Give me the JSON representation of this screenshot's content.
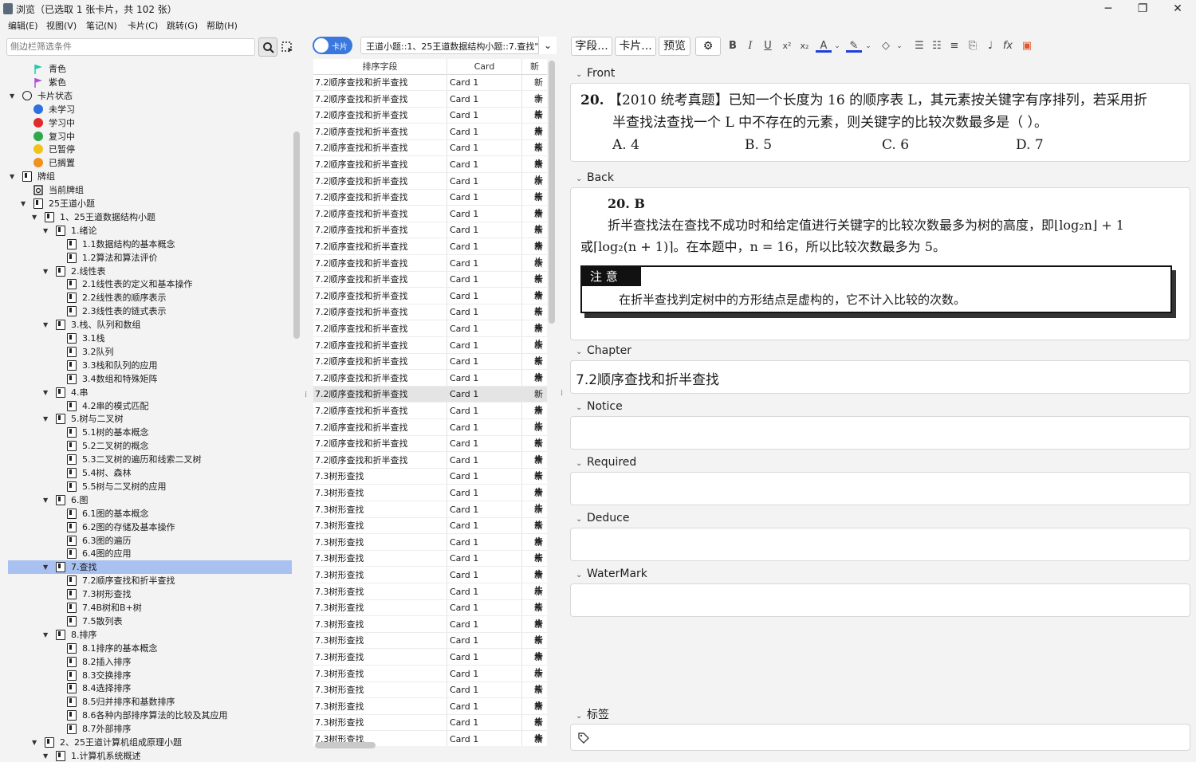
{
  "window": {
    "title": "浏览（已选取 1 张卡片，共 102 张）",
    "minimize": "─",
    "maximize": "❐",
    "close": "✕"
  },
  "menu": [
    "编辑(E)",
    "视图(V)",
    "笔记(N)",
    "卡片(C)",
    "跳转(G)",
    "帮助(H)"
  ],
  "sidebar": {
    "search_placeholder": "侧边栏筛选条件",
    "tree": [
      {
        "label": "青色",
        "level": 2,
        "icon": "flag-cyan",
        "color": "#27c9a6",
        "arrow": ""
      },
      {
        "label": "紫色",
        "level": 2,
        "icon": "flag-purple",
        "color": "#b04fe0",
        "arrow": ""
      },
      {
        "label": "卡片状态",
        "level": 1,
        "icon": "circle-outline",
        "color": "#222",
        "arrow": "down"
      },
      {
        "label": "未学习",
        "level": 2,
        "icon": "dot",
        "color": "#2f6fe0",
        "arrow": ""
      },
      {
        "label": "学习中",
        "level": 2,
        "icon": "dot",
        "color": "#e02b2b",
        "arrow": ""
      },
      {
        "label": "复习中",
        "level": 2,
        "icon": "dot",
        "color": "#2ea84a",
        "arrow": ""
      },
      {
        "label": "已暂停",
        "level": 2,
        "icon": "dot",
        "color": "#f2c21b",
        "arrow": ""
      },
      {
        "label": "已搁置",
        "level": 2,
        "icon": "dot",
        "color": "#f0921e",
        "arrow": ""
      },
      {
        "label": "牌组",
        "level": 1,
        "icon": "deck",
        "color": "#222",
        "arrow": "down"
      },
      {
        "label": "当前牌组",
        "level": 2,
        "icon": "deck-current",
        "color": "#222",
        "arrow": ""
      },
      {
        "label": "25王道小题",
        "level": 2,
        "icon": "deck",
        "color": "#222",
        "arrow": "down"
      },
      {
        "label": "1、25王道数据结构小题",
        "level": 3,
        "icon": "deck",
        "color": "#222",
        "arrow": "down"
      },
      {
        "label": "1.绪论",
        "level": 4,
        "icon": "deck",
        "color": "#222",
        "arrow": "down"
      },
      {
        "label": "1.1数据结构的基本概念",
        "level": 5,
        "icon": "deck",
        "color": "#222",
        "arrow": ""
      },
      {
        "label": "1.2算法和算法评价",
        "level": 5,
        "icon": "deck",
        "color": "#222",
        "arrow": ""
      },
      {
        "label": "2.线性表",
        "level": 4,
        "icon": "deck",
        "color": "#222",
        "arrow": "down"
      },
      {
        "label": "2.1线性表的定义和基本操作",
        "level": 5,
        "icon": "deck",
        "color": "#222",
        "arrow": ""
      },
      {
        "label": "2.2线性表的顺序表示",
        "level": 5,
        "icon": "deck",
        "color": "#222",
        "arrow": ""
      },
      {
        "label": "2.3线性表的链式表示",
        "level": 5,
        "icon": "deck",
        "color": "#222",
        "arrow": ""
      },
      {
        "label": "3.栈、队列和数组",
        "level": 4,
        "icon": "deck",
        "color": "#222",
        "arrow": "down"
      },
      {
        "label": "3.1栈",
        "level": 5,
        "icon": "deck",
        "color": "#222",
        "arrow": ""
      },
      {
        "label": "3.2队列",
        "level": 5,
        "icon": "deck",
        "color": "#222",
        "arrow": ""
      },
      {
        "label": "3.3栈和队列的应用",
        "level": 5,
        "icon": "deck",
        "color": "#222",
        "arrow": ""
      },
      {
        "label": "3.4数组和特殊矩阵",
        "level": 5,
        "icon": "deck",
        "color": "#222",
        "arrow": ""
      },
      {
        "label": "4.串",
        "level": 4,
        "icon": "deck",
        "color": "#222",
        "arrow": "down"
      },
      {
        "label": "4.2串的模式匹配",
        "level": 5,
        "icon": "deck",
        "color": "#222",
        "arrow": ""
      },
      {
        "label": "5.树与二叉树",
        "level": 4,
        "icon": "deck",
        "color": "#222",
        "arrow": "down"
      },
      {
        "label": "5.1树的基本概念",
        "level": 5,
        "icon": "deck",
        "color": "#222",
        "arrow": ""
      },
      {
        "label": "5.2二叉树的概念",
        "level": 5,
        "icon": "deck",
        "color": "#222",
        "arrow": ""
      },
      {
        "label": "5.3二叉树的遍历和线索二叉树",
        "level": 5,
        "icon": "deck",
        "color": "#222",
        "arrow": ""
      },
      {
        "label": "5.4树、森林",
        "level": 5,
        "icon": "deck",
        "color": "#222",
        "arrow": ""
      },
      {
        "label": "5.5树与二叉树的应用",
        "level": 5,
        "icon": "deck",
        "color": "#222",
        "arrow": ""
      },
      {
        "label": "6.图",
        "level": 4,
        "icon": "deck",
        "color": "#222",
        "arrow": "down"
      },
      {
        "label": "6.1图的基本概念",
        "level": 5,
        "icon": "deck",
        "color": "#222",
        "arrow": ""
      },
      {
        "label": "6.2图的存储及基本操作",
        "level": 5,
        "icon": "deck",
        "color": "#222",
        "arrow": ""
      },
      {
        "label": "6.3图的遍历",
        "level": 5,
        "icon": "deck",
        "color": "#222",
        "arrow": ""
      },
      {
        "label": "6.4图的应用",
        "level": 5,
        "icon": "deck",
        "color": "#222",
        "arrow": ""
      },
      {
        "label": "7.查找",
        "level": 4,
        "icon": "deck",
        "color": "#222",
        "arrow": "down",
        "selected": true
      },
      {
        "label": "7.2顺序查找和折半查找",
        "level": 5,
        "icon": "deck",
        "color": "#222",
        "arrow": ""
      },
      {
        "label": "7.3树形查找",
        "level": 5,
        "icon": "deck",
        "color": "#222",
        "arrow": ""
      },
      {
        "label": "7.4B树和B+树",
        "level": 5,
        "icon": "deck",
        "color": "#222",
        "arrow": ""
      },
      {
        "label": "7.5散列表",
        "level": 5,
        "icon": "deck",
        "color": "#222",
        "arrow": ""
      },
      {
        "label": "8.排序",
        "level": 4,
        "icon": "deck",
        "color": "#222",
        "arrow": "down"
      },
      {
        "label": "8.1排序的基本概念",
        "level": 5,
        "icon": "deck",
        "color": "#222",
        "arrow": ""
      },
      {
        "label": "8.2插入排序",
        "level": 5,
        "icon": "deck",
        "color": "#222",
        "arrow": ""
      },
      {
        "label": "8.3交换排序",
        "level": 5,
        "icon": "deck",
        "color": "#222",
        "arrow": ""
      },
      {
        "label": "8.4选择排序",
        "level": 5,
        "icon": "deck",
        "color": "#222",
        "arrow": ""
      },
      {
        "label": "8.5归并排序和基数排序",
        "level": 5,
        "icon": "deck",
        "color": "#222",
        "arrow": ""
      },
      {
        "label": "8.6各种内部排序算法的比较及其应用",
        "level": 5,
        "icon": "deck",
        "color": "#222",
        "arrow": ""
      },
      {
        "label": "8.7外部排序",
        "level": 5,
        "icon": "deck",
        "color": "#222",
        "arrow": ""
      },
      {
        "label": "2、25王道计算机组成原理小题",
        "level": 3,
        "icon": "deck",
        "color": "#222",
        "arrow": "down"
      },
      {
        "label": "1.计算机系统概述",
        "level": 4,
        "icon": "deck",
        "color": "#222",
        "arrow": "down"
      }
    ]
  },
  "browser": {
    "mode_toggle_label": "卡片",
    "search_value": "王道小题::1、25王道数据结构小题::7.查找\"",
    "columns": [
      "排序字段",
      "Card",
      "新"
    ],
    "rows": [
      {
        "sort": "7.2顺序查找和折半查找",
        "card": "Card 1",
        "due": "新卡片"
      },
      {
        "sort": "7.2顺序查找和折半查找",
        "card": "Card 1",
        "due": "新卡片"
      },
      {
        "sort": "7.2顺序查找和折半查找",
        "card": "Card 1",
        "due": "新卡片"
      },
      {
        "sort": "7.2顺序查找和折半查找",
        "card": "Card 1",
        "due": "新卡片"
      },
      {
        "sort": "7.2顺序查找和折半查找",
        "card": "Card 1",
        "due": "新卡片"
      },
      {
        "sort": "7.2顺序查找和折半查找",
        "card": "Card 1",
        "due": "新卡片"
      },
      {
        "sort": "7.2顺序查找和折半查找",
        "card": "Card 1",
        "due": "新卡片"
      },
      {
        "sort": "7.2顺序查找和折半查找",
        "card": "Card 1",
        "due": "新卡片"
      },
      {
        "sort": "7.2顺序查找和折半查找",
        "card": "Card 1",
        "due": "新卡片"
      },
      {
        "sort": "7.2顺序查找和折半查找",
        "card": "Card 1",
        "due": "新卡片"
      },
      {
        "sort": "7.2顺序查找和折半查找",
        "card": "Card 1",
        "due": "新卡片"
      },
      {
        "sort": "7.2顺序查找和折半查找",
        "card": "Card 1",
        "due": "新卡片"
      },
      {
        "sort": "7.2顺序查找和折半查找",
        "card": "Card 1",
        "due": "新卡片"
      },
      {
        "sort": "7.2顺序查找和折半查找",
        "card": "Card 1",
        "due": "新卡片"
      },
      {
        "sort": "7.2顺序查找和折半查找",
        "card": "Card 1",
        "due": "新卡片"
      },
      {
        "sort": "7.2顺序查找和折半查找",
        "card": "Card 1",
        "due": "新卡片"
      },
      {
        "sort": "7.2顺序查找和折半查找",
        "card": "Card 1",
        "due": "新卡片"
      },
      {
        "sort": "7.2顺序查找和折半查找",
        "card": "Card 1",
        "due": "新卡片"
      },
      {
        "sort": "7.2顺序查找和折半查找",
        "card": "Card 1",
        "due": "新卡片"
      },
      {
        "sort": "7.2顺序查找和折半查找",
        "card": "Card 1",
        "due": "新卡片",
        "selected": true
      },
      {
        "sort": "7.2顺序查找和折半查找",
        "card": "Card 1",
        "due": "新卡片"
      },
      {
        "sort": "7.2顺序查找和折半查找",
        "card": "Card 1",
        "due": "新卡片"
      },
      {
        "sort": "7.2顺序查找和折半查找",
        "card": "Card 1",
        "due": "新卡片"
      },
      {
        "sort": "7.2顺序查找和折半查找",
        "card": "Card 1",
        "due": "新卡片"
      },
      {
        "sort": "7.3树形查找",
        "card": "Card 1",
        "due": "新卡片"
      },
      {
        "sort": "7.3树形查找",
        "card": "Card 1",
        "due": "新卡片"
      },
      {
        "sort": "7.3树形查找",
        "card": "Card 1",
        "due": "新卡片"
      },
      {
        "sort": "7.3树形查找",
        "card": "Card 1",
        "due": "新卡片"
      },
      {
        "sort": "7.3树形查找",
        "card": "Card 1",
        "due": "新卡片"
      },
      {
        "sort": "7.3树形查找",
        "card": "Card 1",
        "due": "新卡片"
      },
      {
        "sort": "7.3树形查找",
        "card": "Card 1",
        "due": "新卡片"
      },
      {
        "sort": "7.3树形查找",
        "card": "Card 1",
        "due": "新卡片"
      },
      {
        "sort": "7.3树形查找",
        "card": "Card 1",
        "due": "新卡片"
      },
      {
        "sort": "7.3树形查找",
        "card": "Card 1",
        "due": "新卡片"
      },
      {
        "sort": "7.3树形查找",
        "card": "Card 1",
        "due": "新卡片"
      },
      {
        "sort": "7.3树形查找",
        "card": "Card 1",
        "due": "新卡片"
      },
      {
        "sort": "7.3树形查找",
        "card": "Card 1",
        "due": "新卡片"
      },
      {
        "sort": "7.3树形查找",
        "card": "Card 1",
        "due": "新卡片"
      },
      {
        "sort": "7.3树形查找",
        "card": "Card 1",
        "due": "新卡片"
      },
      {
        "sort": "7.3树形查找",
        "card": "Card 1",
        "due": "新卡片"
      },
      {
        "sort": "7.3树形查找",
        "card": "Card 1",
        "due": "新卡片"
      },
      {
        "sort": "7.3树形查找",
        "card": "Card 1",
        "due": "新卡片"
      }
    ]
  },
  "editor": {
    "toolbar": {
      "fields": "字段...",
      "cards": "卡片...",
      "preview": "预览"
    },
    "front": {
      "label": "Front",
      "qnum": "20.",
      "line1": "【2010 统考真题】已知一个长度为 16 的顺序表 L，其元素按关键字有序排列，若采用折",
      "line2": "半查找法查找一个 L 中不存在的元素，则关键字的比较次数最多是（  ）。",
      "options": [
        "A. 4",
        "B. 5",
        "C. 6",
        "D. 7"
      ]
    },
    "back": {
      "label": "Back",
      "answer": "20.  B",
      "line1": "折半查找法在查找不成功时和给定值进行关键字的比较次数最多为树的高度，即⌊log₂n⌋ + 1",
      "line2": "或⌈log₂(n + 1)⌉。在本题中，n = 16，所以比较次数最多为 5。",
      "note_title": "注  意",
      "note_text": "在折半查找判定树中的方形结点是虚构的，它不计入比较的次数。"
    },
    "chapter": {
      "label": "Chapter",
      "value": "7.2顺序查找和折半查找"
    },
    "notice": {
      "label": "Notice",
      "value": ""
    },
    "required": {
      "label": "Required",
      "value": ""
    },
    "deduce": {
      "label": "Deduce",
      "value": ""
    },
    "watermark": {
      "label": "WaterMark",
      "value": ""
    },
    "tags": {
      "label": "标签",
      "value": ""
    }
  }
}
